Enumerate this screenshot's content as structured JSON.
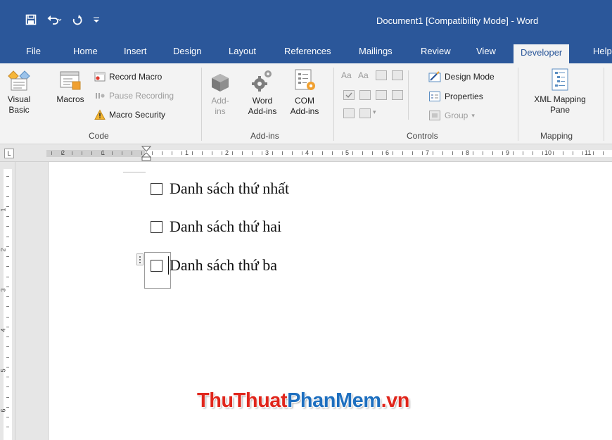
{
  "window": {
    "title": "Document1 [Compatibility Mode]  -  Word",
    "qat": {
      "save_icon": "save-icon",
      "undo_icon": "undo-icon",
      "redo_icon": "redo-icon",
      "customize_icon": "customize-qat-icon"
    }
  },
  "tabs": [
    "File",
    "Home",
    "Insert",
    "Design",
    "Layout",
    "References",
    "Mailings",
    "Review",
    "View",
    "Developer",
    "Help"
  ],
  "active_tab": "Developer",
  "ribbon": {
    "code": {
      "label": "Code",
      "visual_basic": "Visual\nBasic",
      "macros": "Macros",
      "record_macro": "Record Macro",
      "pause_recording": "Pause Recording",
      "macro_security": "Macro Security"
    },
    "addins": {
      "label": "Add-ins",
      "addins": "Add-\nins",
      "word_addins": "Word\nAdd-ins",
      "com_addins": "COM\nAdd-ins"
    },
    "controls": {
      "label": "Controls",
      "aa1": "Aa",
      "aa2": "Aa",
      "design_mode": "Design Mode",
      "properties": "Properties",
      "group": "Group"
    },
    "mapping": {
      "label": "Mapping",
      "xml_mapping_pane": "XML Mapping\nPane"
    }
  },
  "ruler": {
    "corner": "L",
    "left_numbers": [
      "2",
      "1"
    ],
    "right_numbers": [
      "1",
      "2",
      "3",
      "4",
      "5",
      "6",
      "7",
      "8",
      "9",
      "10",
      "11"
    ],
    "vertical_numbers": [
      "1",
      "2",
      "3",
      "4",
      "5",
      "6"
    ]
  },
  "document": {
    "items": [
      "Danh sách thứ nhất",
      "Danh sách thứ hai",
      "Danh sách thứ ba"
    ]
  },
  "watermark": {
    "part1": "ThuThuat",
    "part2": "PhanMem",
    "part3": ".vn"
  }
}
